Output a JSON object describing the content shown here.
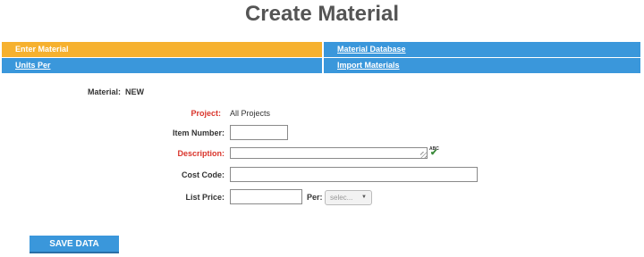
{
  "page": {
    "title": "Create Material"
  },
  "nav": {
    "enter_material": "Enter Material",
    "material_database": "Material Database",
    "units_per": "Units Per",
    "import_materials": "Import Materials"
  },
  "form": {
    "material_label": "Material:",
    "material_value": "NEW",
    "project_label": "Project:",
    "project_value": "All Projects",
    "item_number_label": "Item Number:",
    "item_number_value": "",
    "description_label": "Description:",
    "description_value": "",
    "spellcheck_icon_text": "ABC",
    "cost_code_label": "Cost Code:",
    "cost_code_value": "",
    "list_price_label": "List Price:",
    "list_price_value": "",
    "per_label": "Per:",
    "per_select_value": "selec..."
  },
  "actions": {
    "save_label": "SAVE DATA"
  },
  "colors": {
    "nav_blue": "#3a97db",
    "nav_active": "#f6b12f",
    "required_red": "#d9342b"
  }
}
